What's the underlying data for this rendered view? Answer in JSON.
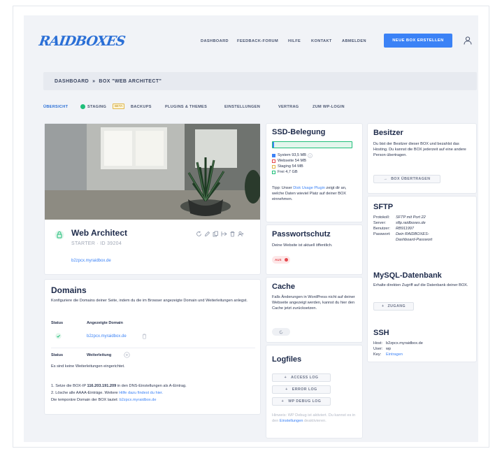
{
  "header": {
    "logo": "RAIDBOXES",
    "nav": [
      "DASHBOARD",
      "FEEDBACK-FORUM",
      "HILFE",
      "KONTAKT",
      "ABMELDEN"
    ],
    "cta": "NEUE BOX ERSTELLEN"
  },
  "breadcrumb": {
    "home": "DASHBOARD",
    "separator": "»",
    "current": "BOX \"WEB ARCHITECT\""
  },
  "tabs": {
    "items": [
      "ÜBERSICHT",
      "STAGING",
      "BACKUPS",
      "PLUGINS & THEMES",
      "EINSTELLUNGEN",
      "VERTRAG",
      "ZUM WP-LOGIN"
    ],
    "beta": "BETA"
  },
  "box": {
    "name": "Web Architect",
    "plan": "STARTER · ID 39204",
    "url": "b2zpcx.myraidbox.de"
  },
  "domains": {
    "title": "Domains",
    "intro": "Konfiguriere die Domains deiner Seite, indem du die im Browser angezeigte Domain und Weiterleitungen anlegst.",
    "col_status": "Status",
    "col_domain": "Angezeigte Domain",
    "domain_value": "b2zpcx.myraidbox.de",
    "col_status2": "Status",
    "col_redirect": "Weiterleitung",
    "no_redirects": "Es sind keine Weiterleitungen eingerichtet.",
    "step1_a": "1. Setze die BOX-IP ",
    "step1_ip": "116.203.191.209",
    "step1_b": " in den DNS-Einstellungen als A-Eintrag.",
    "step2_a": "2. Lösche alle AAAA-Einträge. Weitere ",
    "step2_link": "Hilfe dazu findest du hier.",
    "step3_a": "Die temporäre Domain der BOX lautet: ",
    "step3_link": "b2zpcx.myraidbox.de"
  },
  "ssd": {
    "title": "SSD-Belegung",
    "usage_fraction": 0.02,
    "legend": [
      "System 93,5 MB",
      "Webseite 54 MB",
      "Staging 54 MB",
      "Frei 4,7 GB"
    ],
    "tip_a": "Tipp: Unser ",
    "tip_link": "Disk Usage Plugin",
    "tip_b": " zeigt dir an, welche Daten wieviel Platz auf deiner BOX einnehmen."
  },
  "password": {
    "title": "Passwortschutz",
    "text": "Deine Website ist aktuell öffentlich.",
    "toggle": "AUS"
  },
  "cache": {
    "title": "Cache",
    "text": "Falls Änderungen in WordPress nicht auf deiner Webseite angezeigt werden, kannst du hier den Cache jetzt zurücksetzen."
  },
  "logfiles": {
    "title": "Logfiles",
    "buttons": [
      "ACCESS LOG",
      "ERROR LOG",
      "WP DEBUG LOG"
    ],
    "hint_a": "Hinweis: WP Debug ist aktiviert. Du kannst es in den ",
    "hint_link": "Einstellungen",
    "hint_b": " deaktivieren."
  },
  "owner": {
    "title": "Besitzer",
    "text": "Du bist der Besitzer dieser BOX und bezahlst das Hosting. Du kannst die BOX jederzeit auf eine andere Person übertragen.",
    "button": "BOX ÜBERTRAGEN"
  },
  "sftp": {
    "title": "SFTP",
    "rows": [
      {
        "label": "Protokoll:",
        "value": "SFTP mit Port 22"
      },
      {
        "label": "Server:",
        "value": "sftp.raidboxes.de"
      },
      {
        "label": "Benutzer:",
        "value": "RB911997"
      },
      {
        "label": "Passwort:",
        "value": "Dein RAIDBOXES-"
      },
      {
        "label": "",
        "value": "Dashboard-Passwort"
      }
    ]
  },
  "mysql": {
    "title": "MySQL-Datenbank",
    "text": "Erhalte direkten Zugriff auf die Datenbank deiner BOX.",
    "button": "ZUGANG"
  },
  "ssh": {
    "title": "SSH",
    "host_label": "Host:",
    "host": "b2zpcx.myraidbox.de",
    "user_label": "User:",
    "user": "wp",
    "key_label": "Key:",
    "key_link": "Eintragen"
  },
  "colors": {
    "accent": "#3b82f6",
    "success": "#1fbf7a",
    "danger": "#e5484d"
  }
}
